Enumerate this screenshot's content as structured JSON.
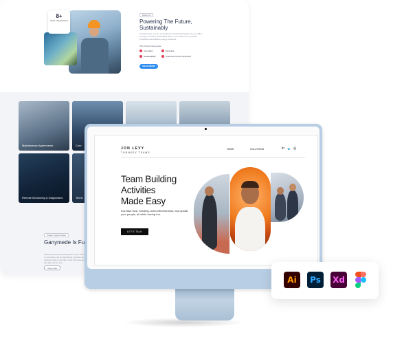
{
  "background_site": {
    "badge": {
      "number": "8+",
      "text": "Years of Experience"
    },
    "about_pill": "About Us",
    "title": "Powering The Future, Sustainably",
    "description": "At Ganymede, we are committed to revolutionizing the way we utilize energy to create a sustainable future. Our mission is to provide innovative and efficient energy solutions.",
    "why_label": "Why Choice Ganymede",
    "features": [
      "Innovation",
      "Expertise",
      "Sustainability",
      "Customer-Centric Approach"
    ],
    "read_more": "READ MORE",
    "services": [
      "Maintenance Agreements",
      "Com",
      "",
      "",
      "Remote Monitoring & Diagnostics",
      "Techn",
      "",
      ""
    ],
    "section_pill": "Career Opportunities",
    "section_title": "Ganymede Is Full Of Promising Opport",
    "section_desc": "Whether you're just starting out in your career or you have a lot of experience, we have an exciting track in your life's work. We have just the right role for you.",
    "view_more": "View more"
  },
  "monitor_site": {
    "brand_name": "JON LEVY",
    "brand_sub": "TURNKEY TEAMS",
    "nav": [
      "HOME",
      "SOLUTIONS"
    ],
    "social": [
      "in",
      "🐦",
      "◎"
    ],
    "hero_title_lines": [
      "Team Building",
      "Activities",
      "Made Easy"
    ],
    "hero_desc": "Increase trust, bonding, team effectiveness, and upskill your people, all while having fun.",
    "cta": "LET'S TALK"
  },
  "tools": [
    "Ai",
    "Ps",
    "Xd",
    "figma"
  ],
  "colors": {
    "accent_blue": "#2e8ef0",
    "feature_red": "#e23b5a",
    "monitor_blue": "#b8cee4",
    "ai_bg": "#330000",
    "ai_fg": "#ff9a00",
    "ps_bg": "#001e36",
    "ps_fg": "#31a8ff",
    "xd_bg": "#470137",
    "xd_fg": "#ff61f6"
  }
}
